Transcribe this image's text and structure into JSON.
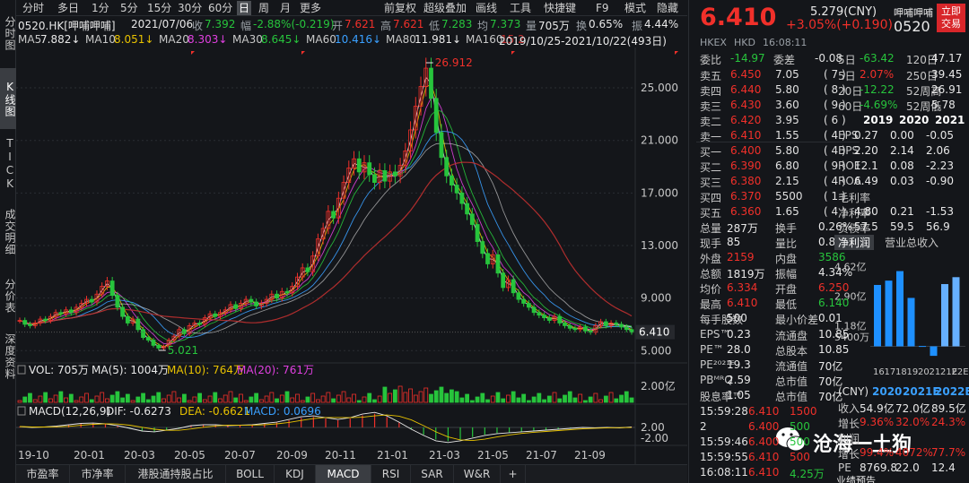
{
  "side_tabs": [
    "分时图",
    "K线图",
    "TICK",
    "成交明细",
    "分价表",
    "深度资料"
  ],
  "period_bar": [
    "分时",
    "多日",
    "1分",
    "5分",
    "15分",
    "30分",
    "60分",
    "日",
    "周",
    "月",
    "更多",
    "前复权",
    "超级叠加",
    "画线",
    "工具",
    "快捷键",
    "F9",
    "模式",
    "隐藏"
  ],
  "info": {
    "code": "0520.HK[呷哺呷哺]",
    "date": "2021/07/06",
    "close_label": "收",
    "close": "7.392",
    "chg_label": "幅",
    "chg": "-2.88%(-0.219)",
    "open_label": "开",
    "open": "7.621",
    "high_label": "高",
    "high": "7.621",
    "low_label": "低",
    "low": "7.283",
    "avg_label": "均",
    "avg": "7.373",
    "vol_label": "量",
    "vol": "705万",
    "turn_label": "换",
    "turn": "0.65%",
    "amp_label": "振",
    "amp": "4.44%"
  },
  "ma": [
    {
      "label": "MA5",
      "value": "7.882↓",
      "color": "#e8e8e8"
    },
    {
      "label": "MA10",
      "value": "8.051↓",
      "color": "#e8c200"
    },
    {
      "label": "MA20",
      "value": "8.303↓",
      "color": "#e040e0"
    },
    {
      "label": "MA30",
      "value": "8.645↓",
      "color": "#27c43c"
    },
    {
      "label": "MA60",
      "value": "10.416↓",
      "color": "#3aa0ff"
    },
    {
      "label": "MA80",
      "value": "11.981↓",
      "color": "#e8e8e8"
    },
    {
      "label": "MA160",
      "value": "15.2",
      "color": "#c03030"
    }
  ],
  "range": "2019/10/25-2021/10/22(493日)",
  "chart_data": {
    "type": "candlestick",
    "price_ticks": [
      "25.000",
      "21.000",
      "17.000",
      "13.000",
      "9.000",
      "5.000"
    ],
    "price_tick_values": [
      25,
      21,
      17,
      13,
      9,
      5
    ],
    "ylim": [
      4.2,
      27.8
    ],
    "high_label": "26.912",
    "low_label": "5.021",
    "last_price": "6.410",
    "x_ticks": [
      "19-10",
      "20-01",
      "20-03",
      "20-05",
      "20-07",
      "20-09",
      "20-11",
      "21-01",
      "21-03",
      "21-05",
      "21-07",
      "21-09"
    ],
    "price_path": [
      7.3,
      7.0,
      6.9,
      7.1,
      7.4,
      7.3,
      7.6,
      7.9,
      7.8,
      8.1,
      7.9,
      8.3,
      8.6,
      8.9,
      8.7,
      9.3,
      9.9,
      10.3,
      9.2,
      8.3,
      7.6,
      7.1,
      7.4,
      6.6,
      6.0,
      5.8,
      5.4,
      5.2,
      5.3,
      5.8,
      6.1,
      6.6,
      6.3,
      6.9,
      7.1,
      7.0,
      7.5,
      7.8,
      7.6,
      7.9,
      8.1,
      8.5,
      8.2,
      8.6,
      8.9,
      8.7,
      8.4,
      8.6,
      8.9,
      9.3,
      9.0,
      9.5,
      9.4,
      9.9,
      10.6,
      11.3,
      11.0,
      12.2,
      13.5,
      14.3,
      15.6,
      15.1,
      16.6,
      17.8,
      18.9,
      19.6,
      18.6,
      19.3,
      18.4,
      17.8,
      18.7,
      17.9,
      18.6,
      18.3,
      19.1,
      20.2,
      21.8,
      23.6,
      25.1,
      26.5,
      24.2,
      21.6,
      19.7,
      18.3,
      17.6,
      17.0,
      16.2,
      15.4,
      14.6,
      13.3,
      12.4,
      11.6,
      12.3,
      10.9,
      9.8,
      10.4,
      9.4,
      8.9,
      8.6,
      8.3,
      7.9,
      7.7,
      7.5,
      7.3,
      7.6,
      7.1,
      6.9,
      6.7,
      6.6,
      6.8,
      6.5,
      6.4,
      6.9,
      7.2,
      6.9,
      7.1,
      7.0,
      6.8,
      6.6,
      6.4
    ],
    "vol_ticks": [
      "2.00亿"
    ],
    "macd_ticks": [
      "2.00",
      "-2.00"
    ],
    "macd_path": [
      0.1,
      0.0,
      0.05,
      0.15,
      0.3,
      0.45,
      0.5,
      0.4,
      0.2,
      -0.1,
      -0.4,
      -0.5,
      -0.3,
      -0.1,
      0.2,
      0.3,
      0.3,
      0.2,
      0.25,
      0.3,
      0.45,
      0.6,
      0.9,
      1.2,
      1.3,
      1.1,
      0.9,
      1.1,
      1.5,
      1.7,
      1.3,
      0.6,
      -0.2,
      -0.9,
      -1.5,
      -1.7,
      -1.5,
      -1.2,
      -0.9,
      -0.7,
      -0.6,
      -0.5,
      -0.4,
      -0.3,
      -0.2,
      -0.1,
      0.0,
      -0.05,
      0.0,
      -0.05,
      0.05
    ]
  },
  "vol_row": {
    "vol": "VOL: 705万",
    "ma5": "MA(5): 1004万",
    "ma10": "MA(10): 764万",
    "ma20": "MA(20): 761万"
  },
  "macd_row": {
    "title": "MACD(12,26,9)",
    "dif": "DIF: -0.6273",
    "dea": "DEA: -0.6621",
    "macd": "MACD: 0.0696"
  },
  "bottom_tabs": [
    "市盈率",
    "市净率",
    "港股通持股占比",
    "BOLL",
    "KDJ",
    "MACD",
    "RSI",
    "SAR",
    "W&R",
    "+"
  ],
  "quote": {
    "price": "6.410",
    "change": "+3.05%(+0.190)",
    "cny": "5.279(CNY)",
    "name": "呷哺呷哺",
    "code": "0520",
    "trade_btn": "立即交易",
    "market": "HKEX",
    "currency": "HKD",
    "time": "16:08:11"
  },
  "weibi": {
    "l1": "委比",
    "v1": "-14.97",
    "l2": "委差",
    "v2": "-0.08"
  },
  "asks": [
    {
      "label": "卖五",
      "price": "6.450",
      "vol": "7.05",
      "num": "( 7 )"
    },
    {
      "label": "卖四",
      "price": "6.440",
      "vol": "5.80",
      "num": "( 8 )"
    },
    {
      "label": "卖三",
      "price": "6.430",
      "vol": "3.60",
      "num": "( 9 )"
    },
    {
      "label": "卖二",
      "price": "6.420",
      "vol": "3.95",
      "num": "( 6 )"
    },
    {
      "label": "卖一",
      "price": "6.410",
      "vol": "1.55",
      "num": "( 4 )"
    }
  ],
  "bids": [
    {
      "label": "买一",
      "price": "6.400",
      "vol": "5.80",
      "num": "( 4 )"
    },
    {
      "label": "买二",
      "price": "6.390",
      "vol": "6.80",
      "num": "( 9 )"
    },
    {
      "label": "买三",
      "price": "6.380",
      "vol": "2.15",
      "num": "( 4 )"
    },
    {
      "label": "买四",
      "price": "6.370",
      "vol": "5500",
      "num": "( 1 )"
    },
    {
      "label": "买五",
      "price": "6.360",
      "vol": "1.65",
      "num": "( 4 )"
    }
  ],
  "stats": [
    {
      "l": "总量",
      "v": "287万",
      "lc": "",
      "vc": "white",
      "l2": "换手",
      "v2": "0.26%",
      "v2c": "white"
    },
    {
      "l": "现手",
      "v": "85",
      "lc": "",
      "vc": "white",
      "l2": "量比",
      "v2": "0.80",
      "v2c": "white"
    },
    {
      "l": "外盘",
      "v": "2159",
      "lc": "",
      "vc": "red",
      "l2": "内盘",
      "v2": "3586",
      "v2c": "green"
    },
    {
      "l": "总额",
      "v": "1819万",
      "lc": "",
      "vc": "white",
      "l2": "振幅",
      "v2": "4.34%",
      "v2c": "white"
    },
    {
      "l": "均价",
      "v": "6.334",
      "lc": "",
      "vc": "red",
      "l2": "开盘",
      "v2": "6.250",
      "v2c": "red"
    },
    {
      "l": "最高",
      "v": "6.410",
      "lc": "",
      "vc": "red",
      "l2": "最低",
      "v2": "6.140",
      "v2c": "green"
    },
    {
      "l": "每手股数",
      "v": "500",
      "lc": "",
      "vc": "white",
      "l2": "最小价差",
      "v2": "0.01",
      "v2c": "white"
    },
    {
      "l": "EPS™",
      "v": "0.23",
      "lc": "",
      "vc": "white",
      "l2": "流通盘",
      "v2": "10.85",
      "v2c": "white"
    },
    {
      "l": "PE™",
      "v": "28.0",
      "lc": "",
      "vc": "white",
      "l2": "总股本",
      "v2": "10.85",
      "v2c": "white"
    },
    {
      "l": "PE²⁰²¹ᴱ",
      "v": "19.3",
      "lc": "",
      "vc": "white",
      "l2": "流通值",
      "v2": "70亿",
      "v2c": "white"
    },
    {
      "l": "PBᴹᴿQ",
      "v": "2.59",
      "lc": "",
      "vc": "white",
      "l2": "总市值",
      "v2": "70亿",
      "v2c": "white"
    },
    {
      "l": "股息率™",
      "v": "1.05",
      "lc": "",
      "vc": "white",
      "l2": "总市值",
      "v2": "70亿",
      "v2c": "white"
    }
  ],
  "ticks": [
    {
      "t": "15:59:28",
      "p": "6.410",
      "v": "1500",
      "pc": "red",
      "vcol": "red"
    },
    {
      "t": "2",
      "p": "6.400",
      "v": "500",
      "pc": "red",
      "vcol": "green"
    },
    {
      "t": "15:59:46",
      "p": "6.400",
      "v": "500",
      "pc": "red",
      "vcol": "green"
    },
    {
      "t": "15:59:55",
      "p": "6.410",
      "v": "500",
      "pc": "red",
      "vcol": "red"
    },
    {
      "t": "16:08:11",
      "p": "6.410",
      "v": "4.25万",
      "pc": "red",
      "vcol": "green"
    }
  ],
  "perf": [
    {
      "l": "5日",
      "v": "-63.42",
      "vc": "green",
      "l2": "120日",
      "v2": "47.17",
      "v2c": "white"
    },
    {
      "l": "5日",
      "v": "2.07%",
      "vc": "red",
      "l2": "250日",
      "v2": "39.45",
      "v2c": "white"
    },
    {
      "l": "20日",
      "v": "-12.22",
      "vc": "green",
      "l2": "52周高",
      "v2": "26.91",
      "v2c": "white"
    },
    {
      "l": "60日",
      "v": "-4.69%",
      "vc": "green",
      "l2": "52周低",
      "v2": "5.78",
      "v2c": "white"
    }
  ],
  "fin_years": [
    "2019",
    "2020",
    "2021"
  ],
  "fin_rows": [
    {
      "l": "EPS",
      "v": [
        "0.27",
        "0.00",
        "-0.05"
      ]
    },
    {
      "l": "BPS",
      "v": [
        "2.20",
        "2.14",
        "2.06"
      ]
    },
    {
      "l": "ROE",
      "v": [
        "12.1",
        "0.08",
        "-2.23"
      ]
    },
    {
      "l": "ROA",
      "v": [
        "6.49",
        "0.03",
        "-0.90"
      ]
    },
    {
      "l": "毛利率",
      "v": [
        "",
        "",
        ""
      ]
    },
    {
      "l": "净利率",
      "v": [
        "4.80",
        "0.21",
        "-1.53"
      ]
    },
    {
      "l": "负债率",
      "v": [
        "57.5",
        "59.5",
        "56.9"
      ]
    }
  ],
  "fin_tabs": [
    "净利润",
    "营业总收入"
  ],
  "bar_chart": {
    "type": "bar",
    "y_ticks": [
      "4.62亿",
      "2.90亿",
      "1.18亿",
      "5400万"
    ],
    "x_ticks": [
      "16",
      "17",
      "18",
      "19",
      "20",
      "21",
      "21E",
      "22E"
    ],
    "values": [
      3.55,
      3.8,
      4.35,
      2.8,
      0.02,
      -0.55,
      3.6,
      4.0
    ],
    "colors": [
      "#1e90ff",
      "#1e90ff",
      "#1e90ff",
      "#1e90ff",
      "#1e90ff",
      "#1e90ff",
      "#66b0ff",
      "#66b0ff"
    ]
  },
  "forecast_header": {
    "unit": "(CNY)",
    "y1": "2020",
    "y2": "2021E",
    "y3": "2022E"
  },
  "forecast_rows": [
    {
      "l": "收入",
      "v": [
        "54.9亿",
        "72.0亿",
        "89.5亿"
      ],
      "c": [
        "white",
        "white",
        "white"
      ]
    },
    {
      "l": "增长",
      "v": [
        "9.36%",
        "32.0%",
        "24.3%"
      ],
      "c": [
        "red",
        "red",
        "red"
      ]
    },
    {
      "l": "利润",
      "v": [
        "",
        "",
        ""
      ],
      "c": [
        "white",
        "white",
        "white"
      ]
    },
    {
      "l": "增长",
      "v": [
        "99.4%",
        "4072%",
        "77.7%"
      ],
      "c": [
        "red",
        "red",
        "red"
      ]
    },
    {
      "l": "PE",
      "v": [
        "8769.8",
        "22.0",
        "12.4"
      ],
      "c": [
        "white",
        "white",
        "white"
      ]
    }
  ],
  "watermark": "沧海一土狗",
  "footer_partial": "业绩预告"
}
